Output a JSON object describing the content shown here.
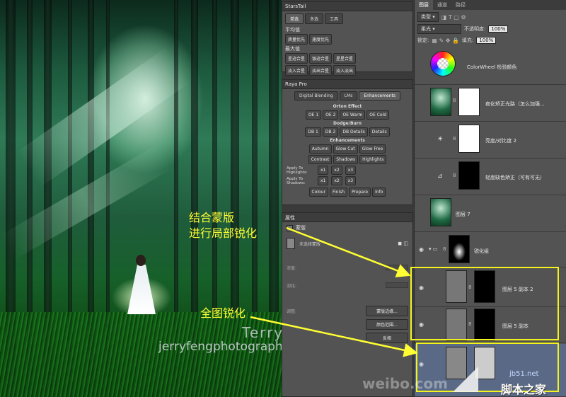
{
  "photo": {
    "watermark_name": "Terry F",
    "watermark_site": "jerryfengphotography.lofter.com",
    "watermark_weibo": "weibo.com",
    "site_logo_url": "jb51.net",
    "site_logo_name": "脚本之家"
  },
  "annotations": {
    "mask_sharpen_line1": "结合蒙版",
    "mask_sharpen_line2": "进行局部锐化",
    "full_sharpen": "全图锐化",
    "color": "#ffff33"
  },
  "starstail": {
    "title": "StarsTail",
    "tabs": [
      "单选",
      "多选",
      "工具"
    ],
    "section_avg": "平均值",
    "avg_buttons": [
      "质量优先",
      "速度优先"
    ],
    "section_max": "最大值",
    "max_buttons_row1": [
      "星迹合星",
      "银迹合星",
      "星星合星"
    ],
    "max_buttons_row2": [
      "淡入合星",
      "淡出合星",
      "淡入淡出"
    ]
  },
  "raya": {
    "title": "Raya Pro",
    "tabs": [
      "Digital Blending",
      "LMs",
      "Enhancements"
    ],
    "orton_title": "Orton Effect",
    "orton_buttons": [
      "OE 1",
      "OE 2",
      "OE Warm",
      "OE Cold"
    ],
    "dodge_title": "Dodge/Burn",
    "dodge_buttons": [
      "DB 1",
      "DB 2",
      "DB Details",
      "Details"
    ],
    "enh_title": "Enhancements",
    "enh_row1": [
      "Autumn",
      "Glow Cut",
      "Glow Free"
    ],
    "enh_row2": [
      "Contrast",
      "Shadows",
      "Highlights"
    ],
    "apply_highlights": "Apply To Highlights:",
    "apply_shadows": "Apply To Shadows:",
    "apply_buttons": [
      "x1",
      "x2",
      "x3"
    ],
    "bottom_buttons": [
      "Colour",
      "Finish",
      "Prepare",
      "Info"
    ]
  },
  "properties": {
    "title": "属性",
    "subtitle": "蒙版",
    "mask_label": "未选择蒙版",
    "density_label": "浓度:",
    "feather_label": "羽化:",
    "adjust_label": "调整:",
    "edge_button": "蒙版边缘...",
    "color_range_button": "颜色范围...",
    "invert_button": "反相"
  },
  "layers": {
    "tabs": [
      "图层",
      "通道",
      "路径"
    ],
    "filter_kind": "类型",
    "blend_mode": "柔光",
    "opacity_label": "不透明度:",
    "opacity_value": "100%",
    "lock_label": "锁定:",
    "fill_label": "填充:",
    "fill_value": "100%",
    "items": [
      {
        "name": "ColorWheel 检验颜色"
      },
      {
        "name": "夜化矫正光路（怎么加强..."
      },
      {
        "name": "亮度/对比度 2"
      },
      {
        "name": "轻度缺色矫正（可有可无）"
      },
      {
        "name": "图层 7"
      },
      {
        "name": "锐化组"
      },
      {
        "name": "图层 5 副本 2"
      },
      {
        "name": "图层 5 副本"
      },
      {
        "name": ""
      }
    ]
  }
}
